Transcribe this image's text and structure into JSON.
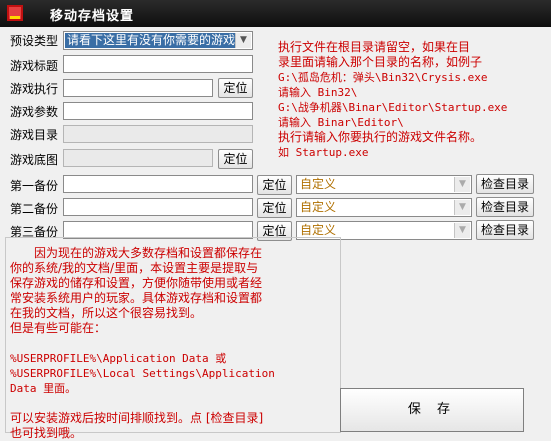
{
  "window": {
    "title": "移动存档设置"
  },
  "form": {
    "preset_label": "预设类型",
    "preset_value": "请看下这里有没有你需要的游戏",
    "title_label": "游戏标题",
    "exec_label": "游戏执行",
    "params_label": "游戏参数",
    "dir_label": "游戏目录",
    "bg_label": "游戏底图",
    "locate_label": "定位"
  },
  "backups": [
    {
      "label": "第一备份",
      "locate": "定位",
      "type": "自定义",
      "check": "检查目录"
    },
    {
      "label": "第二备份",
      "locate": "定位",
      "type": "自定义",
      "check": "检查目录"
    },
    {
      "label": "第三备份",
      "locate": "定位",
      "type": "自定义",
      "check": "检查目录"
    }
  ],
  "hint_exec": {
    "l1": "执行文件在根目录请留空，如果在目",
    "l2": "录里面请输入那个目录的名称，如例子",
    "l3": "G:\\孤岛危机：弹头\\Bin32\\Crysis.exe",
    "l4": "请输入 Bin32\\",
    "l5": "G:\\战争机器\\Binar\\Editor\\Startup.exe",
    "l6": "请输入 Binar\\Editor\\",
    "l7": "执行请输入你要执行的游戏文件名称。",
    "l8": "如 Startup.exe"
  },
  "note": {
    "l1": "因为现在的游戏大多数存档和设置都保存在",
    "l2": "你的系统/我的文档/里面，本设置主要是提取与",
    "l3": "保存游戏的储存和设置，方便你随带使用或者经",
    "l4": "常安装系统用户的玩家。具体游戏存档和设置都",
    "l5": "在我的文档，所以这个很容易找到。",
    "l6": "但是有些可能在：",
    "l7": "%USERPROFILE%\\Application Data 或",
    "l8": "%USERPROFILE%\\Local Settings\\Application",
    "l9": "Data 里面。",
    "l10": "可以安装游戏后按时间排顺找到。点 [检查目录]",
    "l11": "也可找到哦。"
  },
  "save_label": "保 存",
  "colors": {
    "title_bg": "#111111",
    "hint_text": "#cc0000",
    "preset_highlight": "#3a6ea5",
    "combo_text": "#b07000"
  }
}
